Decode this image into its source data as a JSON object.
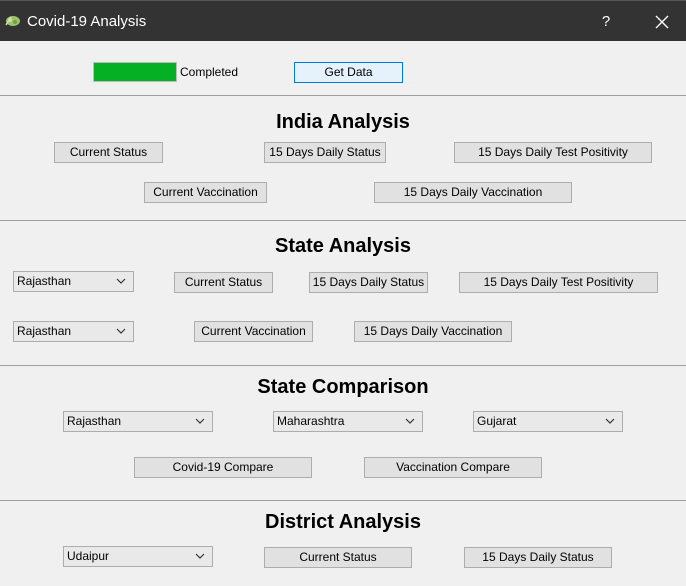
{
  "window": {
    "title": "Covid-19 Analysis",
    "help_glyph": "?",
    "app_icon": "virus-leaf-icon",
    "close_icon": "close-icon"
  },
  "toolbar": {
    "progress_percent": 100,
    "progress_color": "#06b025",
    "progress_label": "Completed",
    "get_data_label": "Get Data"
  },
  "india": {
    "heading": "India Analysis",
    "current_status": "Current Status",
    "daily_status": "15 Days Daily Status",
    "test_positivity": "15 Days Daily Test Positivity",
    "current_vaccination": "Current Vaccination",
    "daily_vaccination": "15 Days Daily Vaccination"
  },
  "state": {
    "heading": "State Analysis",
    "select_1": "Rajasthan",
    "select_2": "Rajasthan",
    "current_status": "Current Status",
    "daily_status": "15 Days Daily Status",
    "test_positivity": "15 Days Daily Test Positivity",
    "current_vaccination": "Current Vaccination",
    "daily_vaccination": "15 Days Daily Vaccination"
  },
  "comparison": {
    "heading": "State Comparison",
    "state_1": "Rajasthan",
    "state_2": "Maharashtra",
    "state_3": "Gujarat",
    "covid_compare": "Covid-19 Compare",
    "vaccination_compare": "Vaccination Compare"
  },
  "district": {
    "heading": "District Analysis",
    "select": "Udaipur",
    "current_status": "Current Status",
    "daily_status": "15 Days Daily Status"
  }
}
